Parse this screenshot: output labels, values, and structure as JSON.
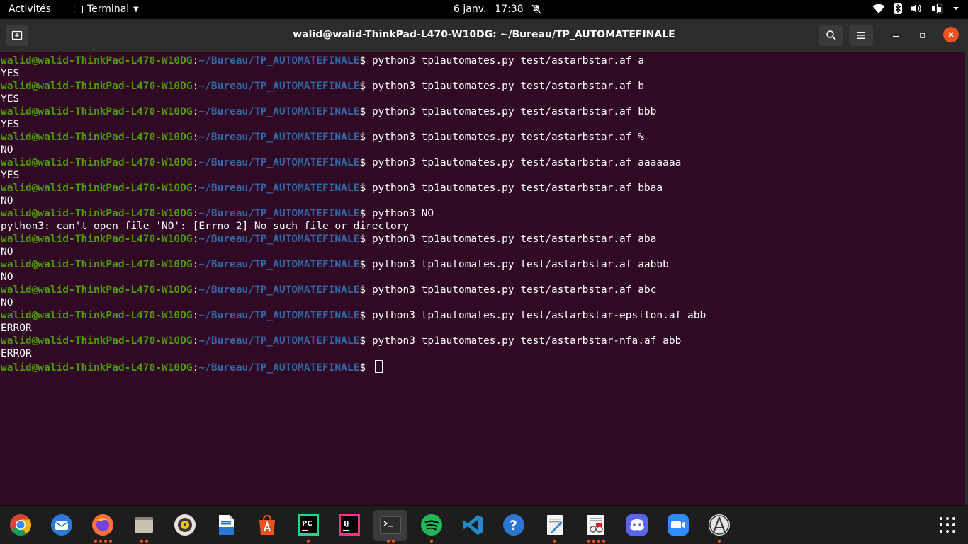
{
  "topbar": {
    "activities": "Activités",
    "app_menu": "Terminal",
    "date": "6 janv.",
    "time": "17:38"
  },
  "window": {
    "title": "walid@walid-ThinkPad-L470-W10DG: ~/Bureau/TP_AUTOMATEFINALE"
  },
  "prompt": {
    "user": "walid@walid-ThinkPad-L470-W10DG",
    "sep": ":",
    "path": "~/Bureau/TP_AUTOMATEFINALE",
    "dollar": "$ "
  },
  "terminal": {
    "lines": [
      {
        "type": "cmd",
        "text": "python3 tp1automates.py test/astarbstar.af a"
      },
      {
        "type": "out",
        "text": "YES"
      },
      {
        "type": "cmd",
        "text": "python3 tp1automates.py test/astarbstar.af b"
      },
      {
        "type": "out",
        "text": "YES"
      },
      {
        "type": "cmd",
        "text": "python3 tp1automates.py test/astarbstar.af bbb"
      },
      {
        "type": "out",
        "text": "YES"
      },
      {
        "type": "cmd",
        "text": "python3 tp1automates.py test/astarbstar.af %"
      },
      {
        "type": "out",
        "text": "NO"
      },
      {
        "type": "cmd",
        "text": "python3 tp1automates.py test/astarbstar.af aaaaaaa"
      },
      {
        "type": "out",
        "text": "YES"
      },
      {
        "type": "cmd",
        "text": "python3 tp1automates.py test/astarbstar.af bbaa"
      },
      {
        "type": "out",
        "text": "NO"
      },
      {
        "type": "cmd",
        "text": "python3 NO"
      },
      {
        "type": "out",
        "text": "python3: can't open file 'NO': [Errno 2] No such file or directory"
      },
      {
        "type": "cmd",
        "text": "python3 tp1automates.py test/astarbstar.af aba"
      },
      {
        "type": "out",
        "text": "NO"
      },
      {
        "type": "cmd",
        "text": "python3 tp1automates.py test/astarbstar.af aabbb"
      },
      {
        "type": "out",
        "text": "NO"
      },
      {
        "type": "cmd",
        "text": "python3 tp1automates.py test/astarbstar.af abc"
      },
      {
        "type": "out",
        "text": "NO"
      },
      {
        "type": "cmd",
        "text": "python3 tp1automates.py test/astarbstar-epsilon.af abb"
      },
      {
        "type": "out",
        "text": "ERROR"
      },
      {
        "type": "cmd",
        "text": "python3 tp1automates.py test/astarbstar-nfa.af abb"
      },
      {
        "type": "out",
        "text": "ERROR"
      },
      {
        "type": "cmd",
        "text": "",
        "cursor": true
      }
    ]
  },
  "dock": {
    "items": [
      {
        "name": "chrome",
        "icon": "chrome-icon",
        "running": 0
      },
      {
        "name": "thunderbird",
        "icon": "thunderbird-icon",
        "running": 0
      },
      {
        "name": "firefox",
        "icon": "firefox-icon",
        "running": 4
      },
      {
        "name": "files",
        "icon": "files-icon",
        "running": 2
      },
      {
        "name": "rhythmbox",
        "icon": "rhythmbox-icon",
        "running": 0
      },
      {
        "name": "libreoffice-writer",
        "icon": "writer-icon",
        "running": 0
      },
      {
        "name": "software",
        "icon": "software-icon",
        "running": 0
      },
      {
        "name": "pycharm",
        "icon": "pycharm-icon",
        "running": 1
      },
      {
        "name": "intellij",
        "icon": "intellij-icon",
        "running": 0
      },
      {
        "name": "terminal",
        "icon": "terminal-icon",
        "running": 2,
        "active": true
      },
      {
        "name": "spotify",
        "icon": "spotify-icon",
        "running": 1
      },
      {
        "name": "vscode",
        "icon": "vscode-icon",
        "running": 0
      },
      {
        "name": "help",
        "icon": "help-icon",
        "running": 0
      },
      {
        "name": "text-editor",
        "icon": "text-editor-icon",
        "running": 1
      },
      {
        "name": "document-viewer",
        "icon": "document-viewer-icon",
        "running": 4
      },
      {
        "name": "discord",
        "icon": "discord-icon",
        "running": 0
      },
      {
        "name": "zoom",
        "icon": "zoom-icon",
        "running": 0
      },
      {
        "name": "anaconda",
        "icon": "anaconda-icon",
        "running": 1
      },
      {
        "name": "show-applications",
        "icon": "grid-icon",
        "running": 0
      }
    ]
  },
  "colors": {
    "terminal_bg": "#300a24",
    "prompt_user": "#4e9a06",
    "prompt_path": "#3465a4",
    "accent": "#e95420"
  }
}
